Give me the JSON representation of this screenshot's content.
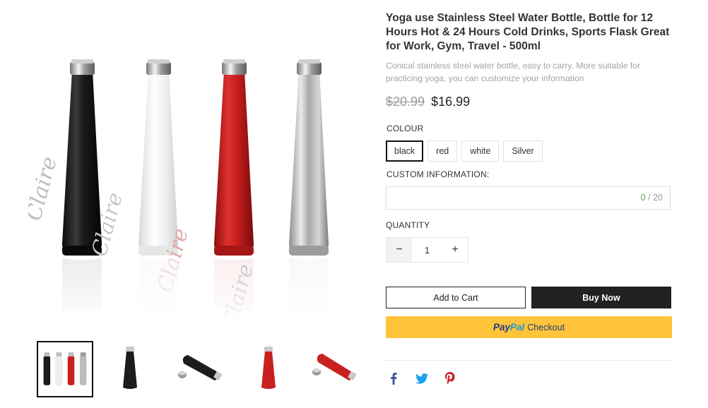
{
  "product": {
    "title": "Yoga use Stainless Steel Water Bottle, Bottle for 12 Hours Hot & 24 Hours Cold Drinks, Sports Flask Great for Work, Gym, Travel - 500ml",
    "description": "Conical stainless steel water bottle, easy to carry. More suitable for practicing yoga, you can customize your information",
    "old_price": "$20.99",
    "price": "$16.99",
    "engraving": "Claire"
  },
  "options": {
    "colour_label": "COLOUR",
    "colours": [
      "black",
      "red",
      "white",
      "Silver"
    ],
    "selected_colour": "black",
    "custom_label": "CUSTOM INFORMATION:",
    "custom_value": "",
    "counter_current": "0",
    "counter_sep": " / ",
    "counter_max": "20",
    "quantity_label": "QUANTITY",
    "quantity": "1",
    "minus": "−",
    "plus": "+"
  },
  "actions": {
    "add_to_cart": "Add to Cart",
    "buy_now": "Buy Now",
    "paypal_word1": "Pay",
    "paypal_word2": "Pal",
    "paypal_checkout": "Checkout"
  },
  "colors": {
    "accent": "#222222",
    "paypal_yellow": "#ffc439",
    "paypal_dark_blue": "#253b80",
    "paypal_light_blue": "#179bd7",
    "facebook": "#3b5998",
    "twitter": "#1da1f2",
    "pinterest": "#cb2027",
    "bottle_black": "#1c1c1c",
    "bottle_white": "#f2f2f2",
    "bottle_red": "#c8201f",
    "bottle_silver": "#b5b5b5"
  },
  "gallery": {
    "thumbnails": [
      "all-four-bottles",
      "black-bottle-upright",
      "black-bottle-lying",
      "red-bottle-upright",
      "red-bottle-lying"
    ],
    "active_thumbnail": 0
  },
  "share": {
    "icons": [
      "facebook-icon",
      "twitter-icon",
      "pinterest-icon"
    ]
  }
}
